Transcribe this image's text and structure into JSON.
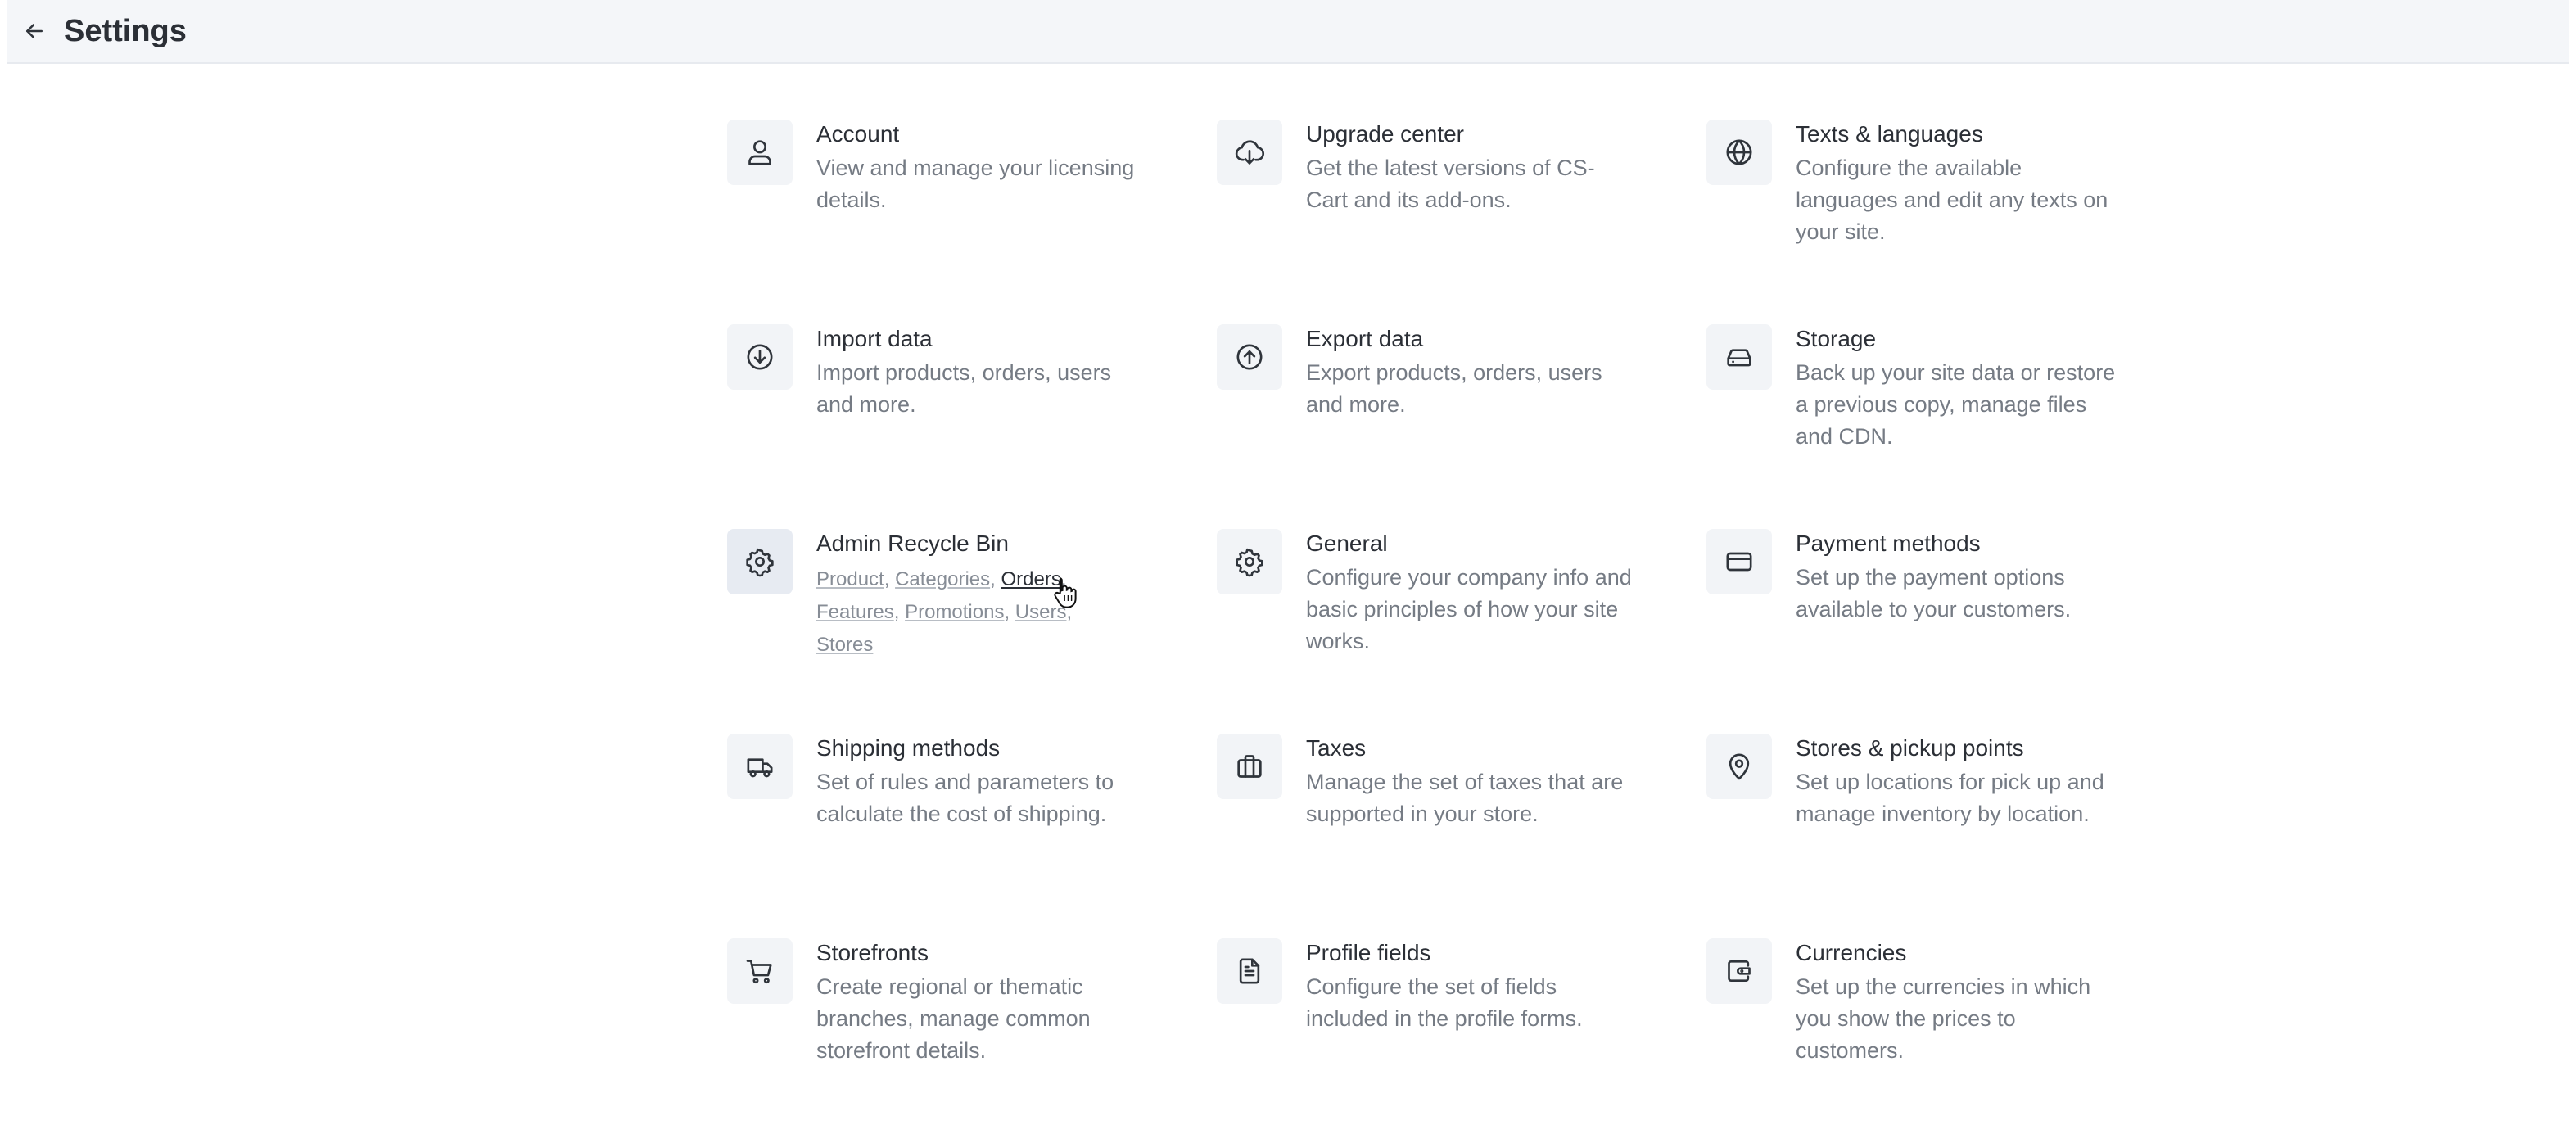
{
  "header": {
    "title": "Settings",
    "back_icon": "arrow-left-icon"
  },
  "cards": [
    {
      "id": "account",
      "icon": "user-icon",
      "title": "Account",
      "desc": "View and manage your licensing details."
    },
    {
      "id": "upgrade-center",
      "icon": "cloud-download-icon",
      "title": "Upgrade center",
      "desc": "Get the latest versions of CS-Cart and its add-ons."
    },
    {
      "id": "texts-languages",
      "icon": "globe-icon",
      "title": "Texts & languages",
      "desc": "Configure the available languages and edit any texts on your site."
    },
    {
      "id": "import-data",
      "icon": "arrow-down-circle-icon",
      "title": "Import data",
      "desc": "Import products, orders, users and more."
    },
    {
      "id": "export-data",
      "icon": "arrow-up-circle-icon",
      "title": "Export data",
      "desc": "Export products, orders, users and more."
    },
    {
      "id": "storage",
      "icon": "hard-drive-icon",
      "title": "Storage",
      "desc": "Back up your site data or restore a previous copy, manage files and CDN."
    },
    {
      "id": "admin-recycle-bin",
      "icon": "gear-icon",
      "title": "Admin Recycle Bin",
      "links": [
        "Product",
        "Categories",
        "Orders",
        "Features",
        "Promotions",
        "Users",
        "Stores"
      ]
    },
    {
      "id": "general",
      "icon": "gear-icon",
      "title": "General",
      "desc": "Configure your company info and basic principles of how your site works."
    },
    {
      "id": "payment-methods",
      "icon": "credit-card-icon",
      "title": "Payment methods",
      "desc": "Set up the payment options available to your customers."
    },
    {
      "id": "shipping-methods",
      "icon": "truck-icon",
      "title": "Shipping methods",
      "desc": "Set of rules and parameters to calculate the cost of shipping."
    },
    {
      "id": "taxes",
      "icon": "briefcase-icon",
      "title": "Taxes",
      "desc": "Manage the set of taxes that are supported in your store."
    },
    {
      "id": "stores-pickup",
      "icon": "map-pin-icon",
      "title": "Stores & pickup points",
      "desc": "Set up locations for pick up and manage inventory by location."
    },
    {
      "id": "storefronts",
      "icon": "shopping-cart-icon",
      "title": "Storefronts",
      "desc": "Create regional or thematic branches, manage common storefront details."
    },
    {
      "id": "profile-fields",
      "icon": "file-text-icon",
      "title": "Profile fields",
      "desc": "Configure the set of fields included in the profile forms."
    },
    {
      "id": "currencies",
      "icon": "wallet-icon",
      "title": "Currencies",
      "desc": "Set up the currencies in which you show the prices to customers."
    }
  ]
}
